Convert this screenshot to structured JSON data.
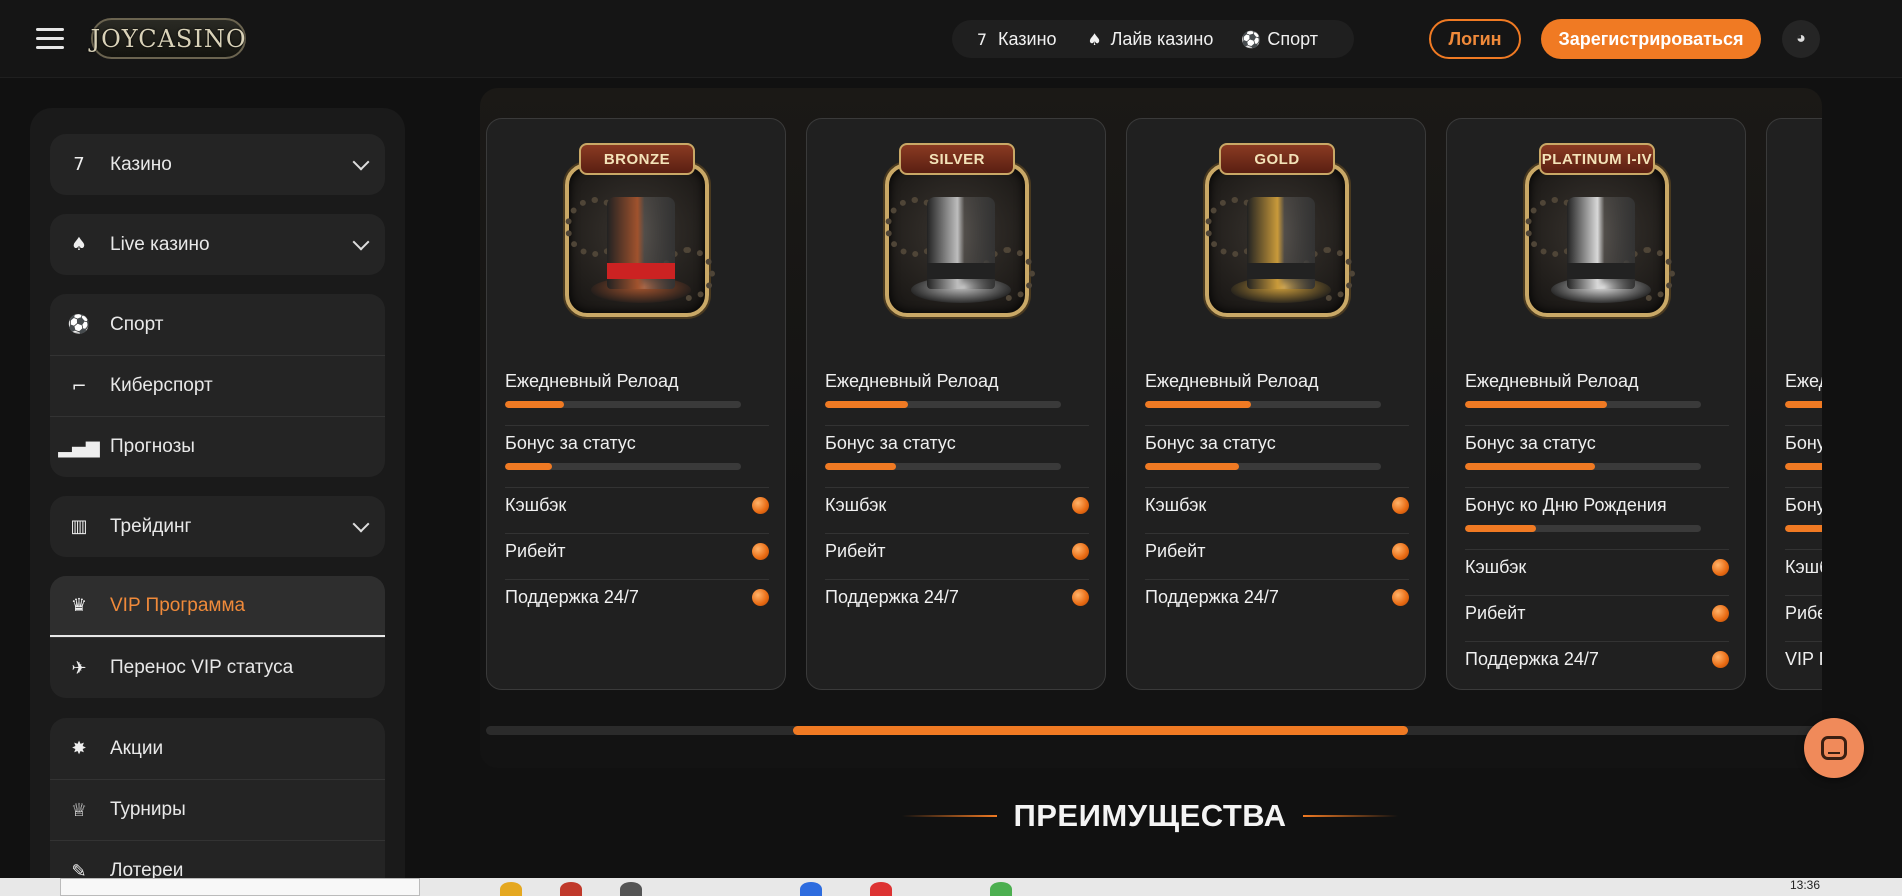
{
  "header": {
    "logo": "JOYCASINO",
    "nav": [
      {
        "icon": "sevens-icon",
        "label": "Казино"
      },
      {
        "icon": "live-cards-icon",
        "label": "Лайв казино"
      },
      {
        "icon": "soccer-ball-icon",
        "label": "Спорт"
      }
    ],
    "login_label": "Логин",
    "register_label": "Зарегистрироваться",
    "accent_color": "#f07a23"
  },
  "sidebar": {
    "groups": [
      [
        {
          "label": "Казино",
          "icon": "sevens-icon",
          "chevron": true
        }
      ],
      [
        {
          "label": "Live казино",
          "icon": "live-cards-icon",
          "chevron": true
        }
      ],
      [
        {
          "label": "Спорт",
          "icon": "soccer-ball-icon"
        },
        {
          "label": "Киберспорт",
          "icon": "shooter-icon"
        },
        {
          "label": "Прогнозы",
          "icon": "signal-bars-icon"
        }
      ],
      [
        {
          "label": "Трейдинг",
          "icon": "chart-icon",
          "chevron": true
        }
      ],
      [
        {
          "label": "VIP Программа",
          "icon": "crown-icon",
          "active": true
        },
        {
          "label": "Перенос VIP статуса",
          "icon": "plane-icon"
        }
      ],
      [
        {
          "label": "Акции",
          "icon": "star-badge-icon"
        },
        {
          "label": "Турниры",
          "icon": "trophy-icon"
        },
        {
          "label": "Лотереи",
          "icon": "ticket-icon"
        }
      ]
    ]
  },
  "vip_cards": [
    {
      "level": "BRONZE",
      "hat_color": "#a0522d",
      "features": [
        {
          "label": "Ежедневный Релоад",
          "type": "bar",
          "progress": 0.25
        },
        {
          "label": "Бонус за статус",
          "type": "bar",
          "progress": 0.2
        },
        {
          "label": "Кэшбэк",
          "type": "dot"
        },
        {
          "label": "Рибейт",
          "type": "dot"
        },
        {
          "label": "Поддержка 24/7",
          "type": "dot"
        }
      ]
    },
    {
      "level": "SILVER",
      "hat_color": "#bdbdbd",
      "features": [
        {
          "label": "Ежедневный Релоад",
          "type": "bar",
          "progress": 0.35
        },
        {
          "label": "Бонус за статус",
          "type": "bar",
          "progress": 0.3
        },
        {
          "label": "Кэшбэк",
          "type": "dot"
        },
        {
          "label": "Рибейт",
          "type": "dot"
        },
        {
          "label": "Поддержка 24/7",
          "type": "dot"
        }
      ]
    },
    {
      "level": "GOLD",
      "hat_color": "#c99a3a",
      "features": [
        {
          "label": "Ежедневный Релоад",
          "type": "bar",
          "progress": 0.45
        },
        {
          "label": "Бонус за статус",
          "type": "bar",
          "progress": 0.4
        },
        {
          "label": "Кэшбэк",
          "type": "dot"
        },
        {
          "label": "Рибейт",
          "type": "dot"
        },
        {
          "label": "Поддержка 24/7",
          "type": "dot"
        }
      ]
    },
    {
      "level": "PLATINUM I-IV",
      "hat_color": "#d8d8d8",
      "features": [
        {
          "label": "Ежедневный Релоад",
          "type": "bar",
          "progress": 0.6
        },
        {
          "label": "Бонус за статус",
          "type": "bar",
          "progress": 0.55
        },
        {
          "label": "Бонус ко Дню Рождения",
          "type": "bar",
          "progress": 0.3
        },
        {
          "label": "Кэшбэк",
          "type": "dot"
        },
        {
          "label": "Рибейт",
          "type": "dot"
        },
        {
          "label": "Поддержка 24/7",
          "type": "dot"
        }
      ]
    },
    {
      "level": "",
      "hat_color": "#888888",
      "features": [
        {
          "label": "Ежед",
          "type": "bar",
          "progress": 0.7
        },
        {
          "label": "Бону",
          "type": "bar",
          "progress": 0.65
        },
        {
          "label": "Бону",
          "type": "bar",
          "progress": 0.4
        },
        {
          "label": "Кэшб",
          "type": "text"
        },
        {
          "label": "Рибе",
          "type": "text"
        },
        {
          "label": "VIP П",
          "type": "text"
        }
      ]
    }
  ],
  "advantages_title": "ПРЕИМУЩЕСТВА",
  "carousel_scroll": {
    "position": 0.23,
    "visible_fraction": 0.46
  },
  "taskbar": {
    "clock": "13:36"
  }
}
